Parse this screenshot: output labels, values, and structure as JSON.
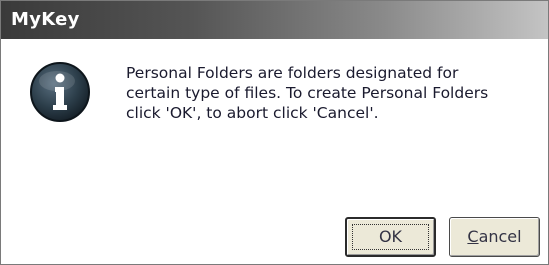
{
  "window": {
    "title": "MyKey"
  },
  "icon": "info-icon",
  "message": {
    "lines": [
      "Personal Folders are folders designated for",
      "certain type of files. To create Personal Folders",
      "click 'OK', to abort click 'Cancel'."
    ]
  },
  "buttons": {
    "ok_label": "OK",
    "cancel_mnemonic": "C",
    "cancel_rest": "ancel"
  },
  "colors": {
    "icon_fill": "#2c3e4a",
    "title_text": "#ffffff",
    "button_face": "#ece9d8"
  }
}
